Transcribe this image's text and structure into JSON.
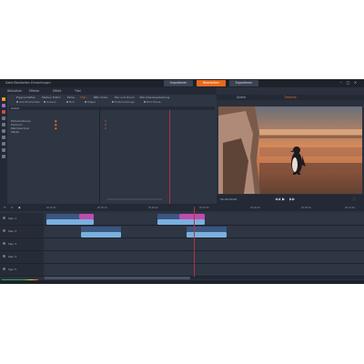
{
  "window": {
    "title_left": "Datei  Bearbeiten  Einstellungen",
    "modes": [
      "Importieren",
      "Bearbeiten",
      "Exportieren"
    ],
    "active_mode": "Bearbeiten"
  },
  "library": {
    "tabs": [
      "Bibliothek",
      "Effekte",
      "Effekt",
      "Titel"
    ],
    "categories": [
      "Eigenschaften",
      "Medien Editor",
      "Farbe",
      "Titel",
      "BBC Video",
      "Pan und Zoom",
      "360 Videobearbeitung"
    ],
    "active_category": "Titel",
    "options": [
      "Alle Einblenden",
      "Aussen",
      "Bild",
      "Magie",
      "Entscheidungs",
      "Bild Heute"
    ],
    "column_header": "Comic",
    "rows": [
      "Farbvariationen",
      "Konturen",
      "Weichzeichner",
      "Stärke"
    ],
    "value": "0"
  },
  "preview": {
    "tabs": [
      "Quelle",
      "Timeline"
    ],
    "active_tab": "Timeline",
    "timecodes": [
      "00:00:00:00",
      "00:00:10:00",
      "00:00:20:00",
      "00:00:30:00",
      "00:00:40:00",
      "00:00:50:00",
      "00:01:00:00"
    ]
  },
  "timeline": {
    "tracks": [
      "Spur 1",
      "Spur 2",
      "Spur 3",
      "Spur 4",
      "Spur 5"
    ],
    "ruler_ticks": [
      "00:00:00",
      "00:00:10",
      "00:00:20",
      "00:00:30",
      "00:00:40",
      "00:00:50",
      "00:01:00"
    ]
  },
  "colors": {
    "accent": "#e86a1a",
    "playhead": "#b8323a",
    "clip_video": "#3a5680",
    "clip_audio": "#7ab0dd",
    "clip_magenta": "#c04bb0"
  }
}
